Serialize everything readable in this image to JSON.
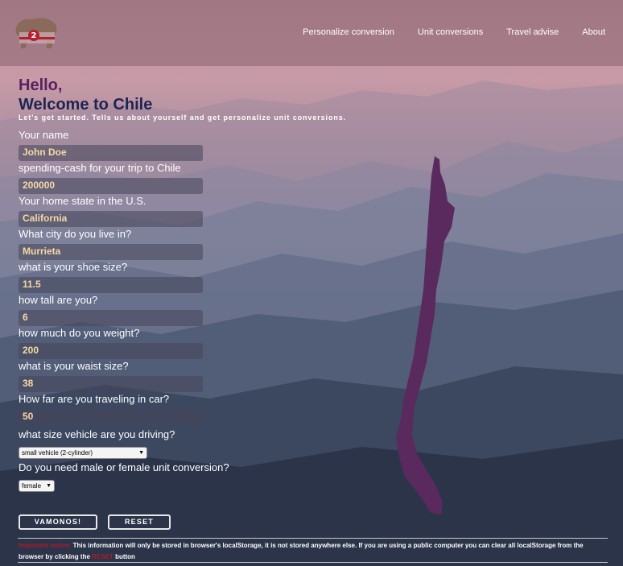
{
  "nav": {
    "items": [
      "Personalize conversion",
      "Unit conversions",
      "Travel advise",
      "About"
    ]
  },
  "logo": {
    "badge_text": "2"
  },
  "main": {
    "hello": "Hello,",
    "welcome": "Welcome to Chile",
    "intro": "Let's get started. Tells us about yourself and get personalize unit conversions."
  },
  "form": {
    "name_label": "Your name",
    "name_value": "John Doe",
    "cash_label": "spending-cash for your trip to Chile",
    "cash_value": "200000",
    "state_label": "Your home state in the U.S.",
    "state_value": "California",
    "city_label": "What city do you live in?",
    "city_value": "Murrieta",
    "shoe_label": "what is your shoe size?",
    "shoe_value": "11.5",
    "height_label": "how tall are you?",
    "height_value": "6",
    "weight_label": "how much do you weight?",
    "weight_value": "200",
    "waist_label": "what is your waist size?",
    "waist_value": "38",
    "distance_label": "How far are you traveling in car?",
    "distance_value": "50",
    "vehicle_label": "what size vehicle are you driving?",
    "vehicle_selected": "small vehicle (2-cylinder)",
    "gender_label": "Do you need male or female unit conversion?",
    "gender_selected": "female"
  },
  "buttons": {
    "submit": "VAMONOS!",
    "reset": "RESET"
  },
  "footer": {
    "prefix": "Important notice:",
    "text": "This information will only be stored in browser's localStorage, it is not stored anywhere else. If you are using a public computer you can clear all localStorage from the browser by clicking the",
    "link": "RESET",
    "suffix": "button"
  },
  "colors": {
    "hello": "#5a2260",
    "welcome": "#1f2452",
    "field_text": "#f6d9a4",
    "map_fill": "#5a2a5e",
    "footer_highlight": "#b01a2a"
  },
  "icons": {
    "logo": "bear-flag-logo",
    "map": "chile-map"
  }
}
